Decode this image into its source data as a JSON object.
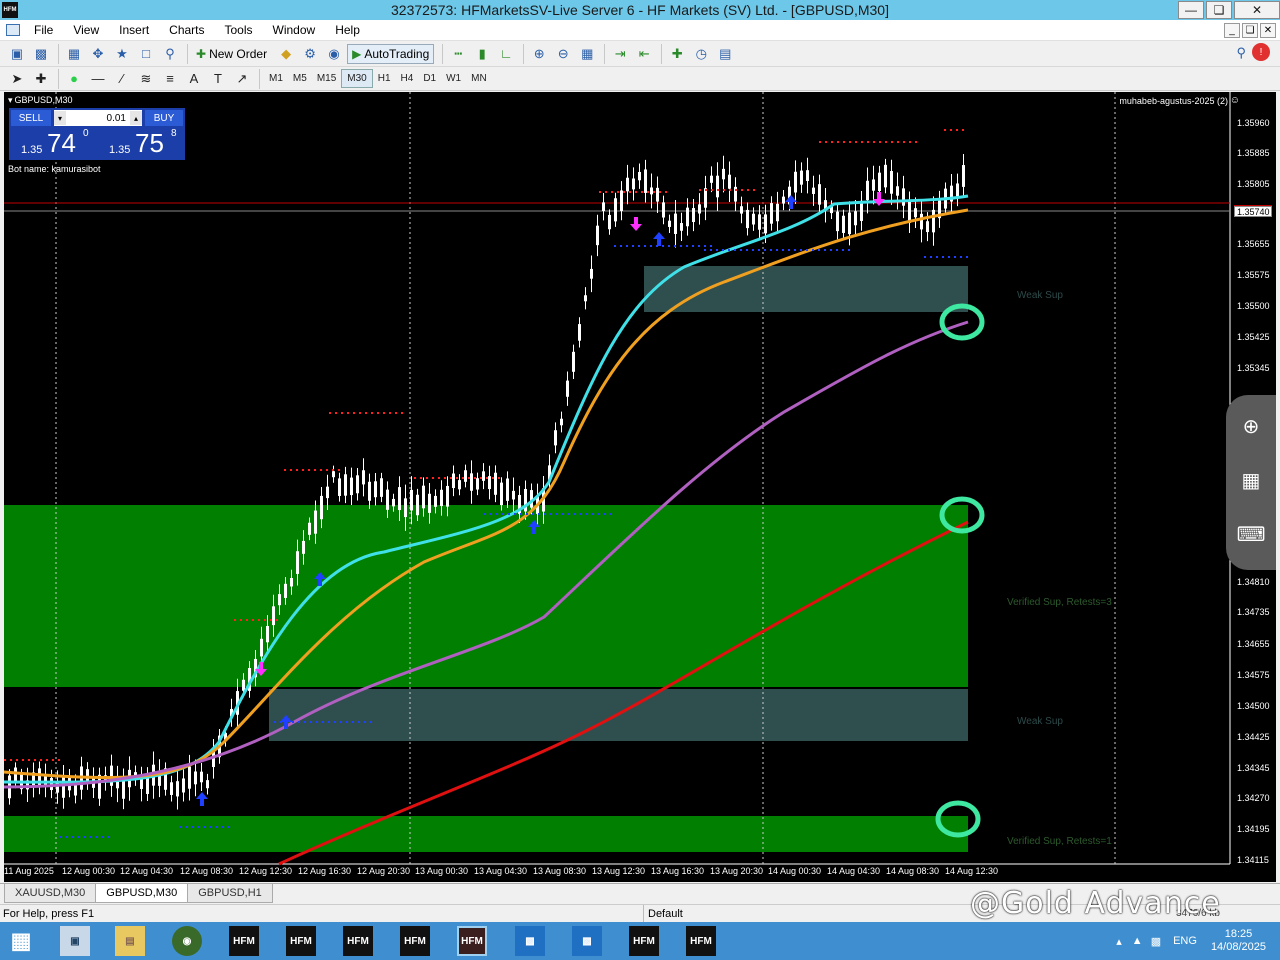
{
  "window": {
    "title": "32372573: HFMarketsSV-Live Server 6 - HF Markets (SV) Ltd. - [GBPUSD,M30]",
    "app_icon": "HFM"
  },
  "menu": [
    "File",
    "View",
    "Insert",
    "Charts",
    "Tools",
    "Window",
    "Help"
  ],
  "toolbar": {
    "new_order": "New Order",
    "autotrading": "AutoTrading"
  },
  "timeframes": [
    "M1",
    "M5",
    "M15",
    "M30",
    "H1",
    "H4",
    "D1",
    "W1",
    "MN"
  ],
  "active_timeframe": "M30",
  "chart": {
    "symbol_title": "GBPUSD,M30",
    "one_click": {
      "sell_label": "SELL",
      "buy_label": "BUY",
      "lot": "0.01",
      "sell_prefix": "1.35",
      "sell_big": "74",
      "sell_sup": "0",
      "buy_prefix": "1.35",
      "buy_big": "75",
      "buy_sup": "8"
    },
    "bot_name": "Bot name: kamurasibot",
    "indicator_name": "muhabeb-agustus-2025 (2)",
    "zones": [
      {
        "label": "Weak Sup"
      },
      {
        "label": "Verified Sup, Retests=3"
      },
      {
        "label": "Weak Sup"
      },
      {
        "label": "Verified Sup, Retests=1"
      }
    ],
    "y_ticks": [
      "1.35960",
      "1.35885",
      "1.35805",
      "1.35740",
      "1.35655",
      "1.35575",
      "1.35500",
      "1.35425",
      "1.35345",
      "1.34810",
      "1.34735",
      "1.34655",
      "1.34575",
      "1.34500",
      "1.34425",
      "1.34345",
      "1.34270",
      "1.34195",
      "1.34115"
    ],
    "bid_tag": "1.35740",
    "x_ticks": [
      "11 Aug 2025",
      "12 Aug 00:30",
      "12 Aug 04:30",
      "12 Aug 08:30",
      "12 Aug 12:30",
      "12 Aug 16:30",
      "12 Aug 20:30",
      "13 Aug 00:30",
      "13 Aug 04:30",
      "13 Aug 08:30",
      "13 Aug 12:30",
      "13 Aug 16:30",
      "13 Aug 20:30",
      "14 Aug 00:30",
      "14 Aug 04:30",
      "14 Aug 08:30",
      "14 Aug 12:30"
    ],
    "colors": {
      "background": "#000000",
      "verified_zone": "#007f00",
      "weak_zone": "#2f4f4f",
      "ma_fast": "#40e0e8",
      "ma_mid": "#f0a020",
      "ma_slow": "#b060c0",
      "ma_long": "#e01010"
    }
  },
  "tabs": [
    "XAUUSD,M30",
    "GBPUSD,M30",
    "GBPUSD,H1"
  ],
  "active_tab": "GBPUSD,M30",
  "status": {
    "help": "For Help, press F1",
    "profile": "Default",
    "connection": "3476/6 kb"
  },
  "watermark": "@Gold Advance",
  "taskbar": {
    "hfm_label": "HFM",
    "language": "ENG",
    "time": "18:25",
    "date": "14/08/2025"
  }
}
